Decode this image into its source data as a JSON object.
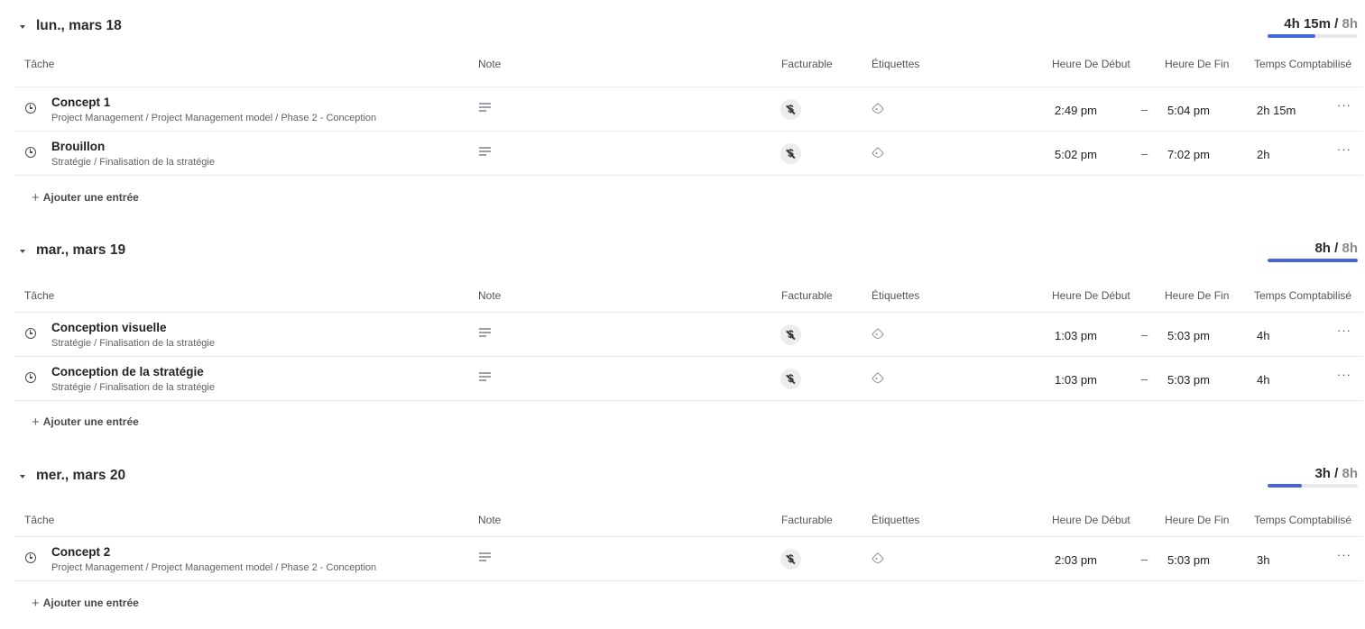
{
  "columns": {
    "task": "Tâche",
    "note": "Note",
    "billable": "Facturable",
    "tags": "Étiquettes",
    "start": "Heure De Début",
    "end": "Heure De Fin",
    "duration": "Temps Comptabilisé"
  },
  "add_entry_label": "Ajouter une entrée",
  "accent_color": "#4466d9",
  "days": [
    {
      "title": "lun., mars 18",
      "logged": "4h 15m",
      "target": "8h",
      "progress": 0.53,
      "entries": [
        {
          "name": "Concept 1",
          "path": "Project Management / Project Management model / Phase 2 - Conception",
          "start": "2:49 pm",
          "end": "5:04 pm",
          "duration": "2h 15m"
        },
        {
          "name": "Brouillon",
          "path": "Stratégie / Finalisation de la stratégie",
          "start": "5:02 pm",
          "end": "7:02 pm",
          "duration": "2h"
        }
      ]
    },
    {
      "title": "mar., mars 19",
      "logged": "8h",
      "target": "8h",
      "progress": 1.0,
      "entries": [
        {
          "name": "Conception visuelle",
          "path": "Stratégie / Finalisation de la stratégie",
          "start": "1:03 pm",
          "end": "5:03 pm",
          "duration": "4h"
        },
        {
          "name": "Conception de la stratégie",
          "path": "Stratégie / Finalisation de la stratégie",
          "start": "1:03 pm",
          "end": "5:03 pm",
          "duration": "4h"
        }
      ]
    },
    {
      "title": "mer., mars 20",
      "logged": "3h",
      "target": "8h",
      "progress": 0.375,
      "entries": [
        {
          "name": "Concept 2",
          "path": "Project Management / Project Management model / Phase 2 - Conception",
          "start": "2:03 pm",
          "end": "5:03 pm",
          "duration": "3h"
        }
      ]
    }
  ]
}
